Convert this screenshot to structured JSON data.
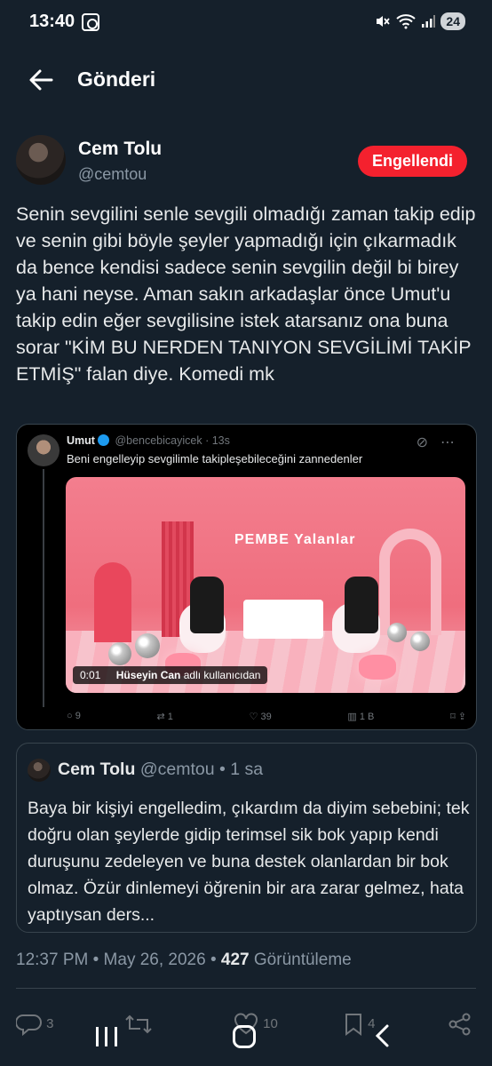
{
  "status": {
    "time": "13:40",
    "battery": "24"
  },
  "header": {
    "title": "Gönderi"
  },
  "author": {
    "name": "Cem Tolu",
    "handle": "@cemtou",
    "blocked_label": "Engellendi"
  },
  "tweet": {
    "text": "Senin sevgilini senle sevgili olmadığı zaman takip edip ve senin gibi böyle şeyler yapmadığı için çıkarmadık da bence kendisi sadece senin sevgilin değil bi birey ya hani neyse. Aman sakın arkadaşlar önce Umut'u takip edin eğer sevgilisine istek atarsanız ona buna sorar \"KİM BU NERDEN TANIYON SEVGİLİMİ TAKİP ETMİŞ\" falan diye. Komedi mk"
  },
  "embed": {
    "name": "Umut",
    "handle": "@bencebicayicek",
    "time": "· 13s",
    "text": "Beni engelleyip sevgilimle takipleşebileceğini zannedenler",
    "media_sign": "PEMBE Yalanlar",
    "video_time": "0:01",
    "video_user": "Hüseyin Can",
    "video_suffix": "adlı kullanıcıdan",
    "replies": "9",
    "reposts": "1",
    "likes": "39",
    "views": "1 B"
  },
  "quote": {
    "name": "Cem Tolu",
    "handle": "@cemtou",
    "time": "• 1 sa",
    "text": "Baya bir kişiyi engelledim, çıkardım da diyim sebebini; tek doğru olan şeylerde gidip terimsel sik bok yapıp kendi duruşunu zedeleyen ve buna destek olanlardan bir bok olmaz. Özür dinlemeyi öğrenin bir ara zarar gelmez, hata yaptıysan ders..."
  },
  "meta": {
    "time": "12:37 PM",
    "date": "May 26, 2026",
    "views_count": "427",
    "views_label": "Görüntüleme"
  },
  "actions": {
    "replies": "3",
    "likes": "10",
    "bookmarks": "4"
  },
  "colors": {
    "background": "#15202b",
    "blocked": "#f4212e",
    "muted": "#8b98a5"
  }
}
